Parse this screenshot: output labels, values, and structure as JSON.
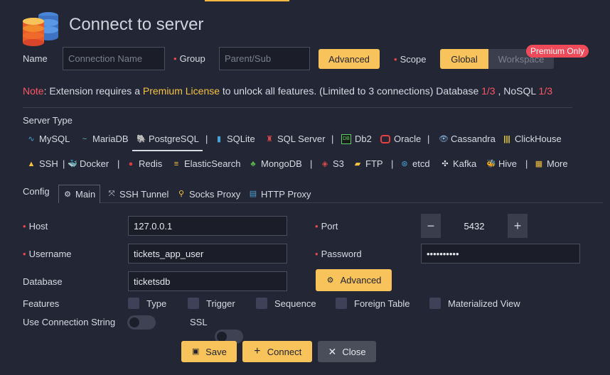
{
  "header": {
    "title": "Connect to server"
  },
  "name_row": {
    "name_label": "Name",
    "name_placeholder": "Connection Name",
    "group_label": "Group",
    "group_placeholder": "Parent/Sub",
    "advanced_label": "Advanced",
    "scope_label": "Scope",
    "scope_options": [
      "Global",
      "Workspace"
    ],
    "premium_badge": "Premium Only"
  },
  "note": {
    "prefix": "Note",
    "text1": ": Extension requires a ",
    "license": "Premium License",
    "text2": " to unlock all features. (Limited to 3 connections) Database ",
    "db_count": "1/3",
    "text3": " , NoSQL ",
    "nosql_count": "1/3"
  },
  "server_type": {
    "label": "Server Type",
    "row1": [
      "MySQL",
      "MariaDB",
      "PostgreSQL",
      "SQLite",
      "SQL Server",
      "Db2",
      "Oracle",
      "Cassandra",
      "ClickHouse"
    ],
    "row2": [
      "SSH",
      "Docker",
      "Redis",
      "ElasticSearch",
      "MongoDB",
      "S3",
      "FTP",
      "etcd",
      "Kafka",
      "Hive",
      "More"
    ],
    "selected": "PostgreSQL"
  },
  "config": {
    "label": "Config",
    "tabs": [
      "Main",
      "SSH Tunnel",
      "Socks Proxy",
      "HTTP Proxy"
    ]
  },
  "form": {
    "host_label": "Host",
    "host_value": "127.0.0.1",
    "port_label": "Port",
    "port_value": "5432",
    "username_label": "Username",
    "username_value": "tickets_app_user",
    "password_label": "Password",
    "password_value": "••••••••••",
    "database_label": "Database",
    "database_value": "ticketsdb",
    "advanced_label": "Advanced",
    "features_label": "Features",
    "features": [
      "Type",
      "Trigger",
      "Sequence",
      "Foreign Table",
      "Materialized View"
    ],
    "conn_string_label": "Use Connection String",
    "ssl_label": "SSL"
  },
  "footer": {
    "save": "Save",
    "connect": "Connect",
    "close": "Close"
  },
  "colors": {
    "accent": "#f7c35a",
    "background": "#232634",
    "danger": "#ef4a5a"
  }
}
